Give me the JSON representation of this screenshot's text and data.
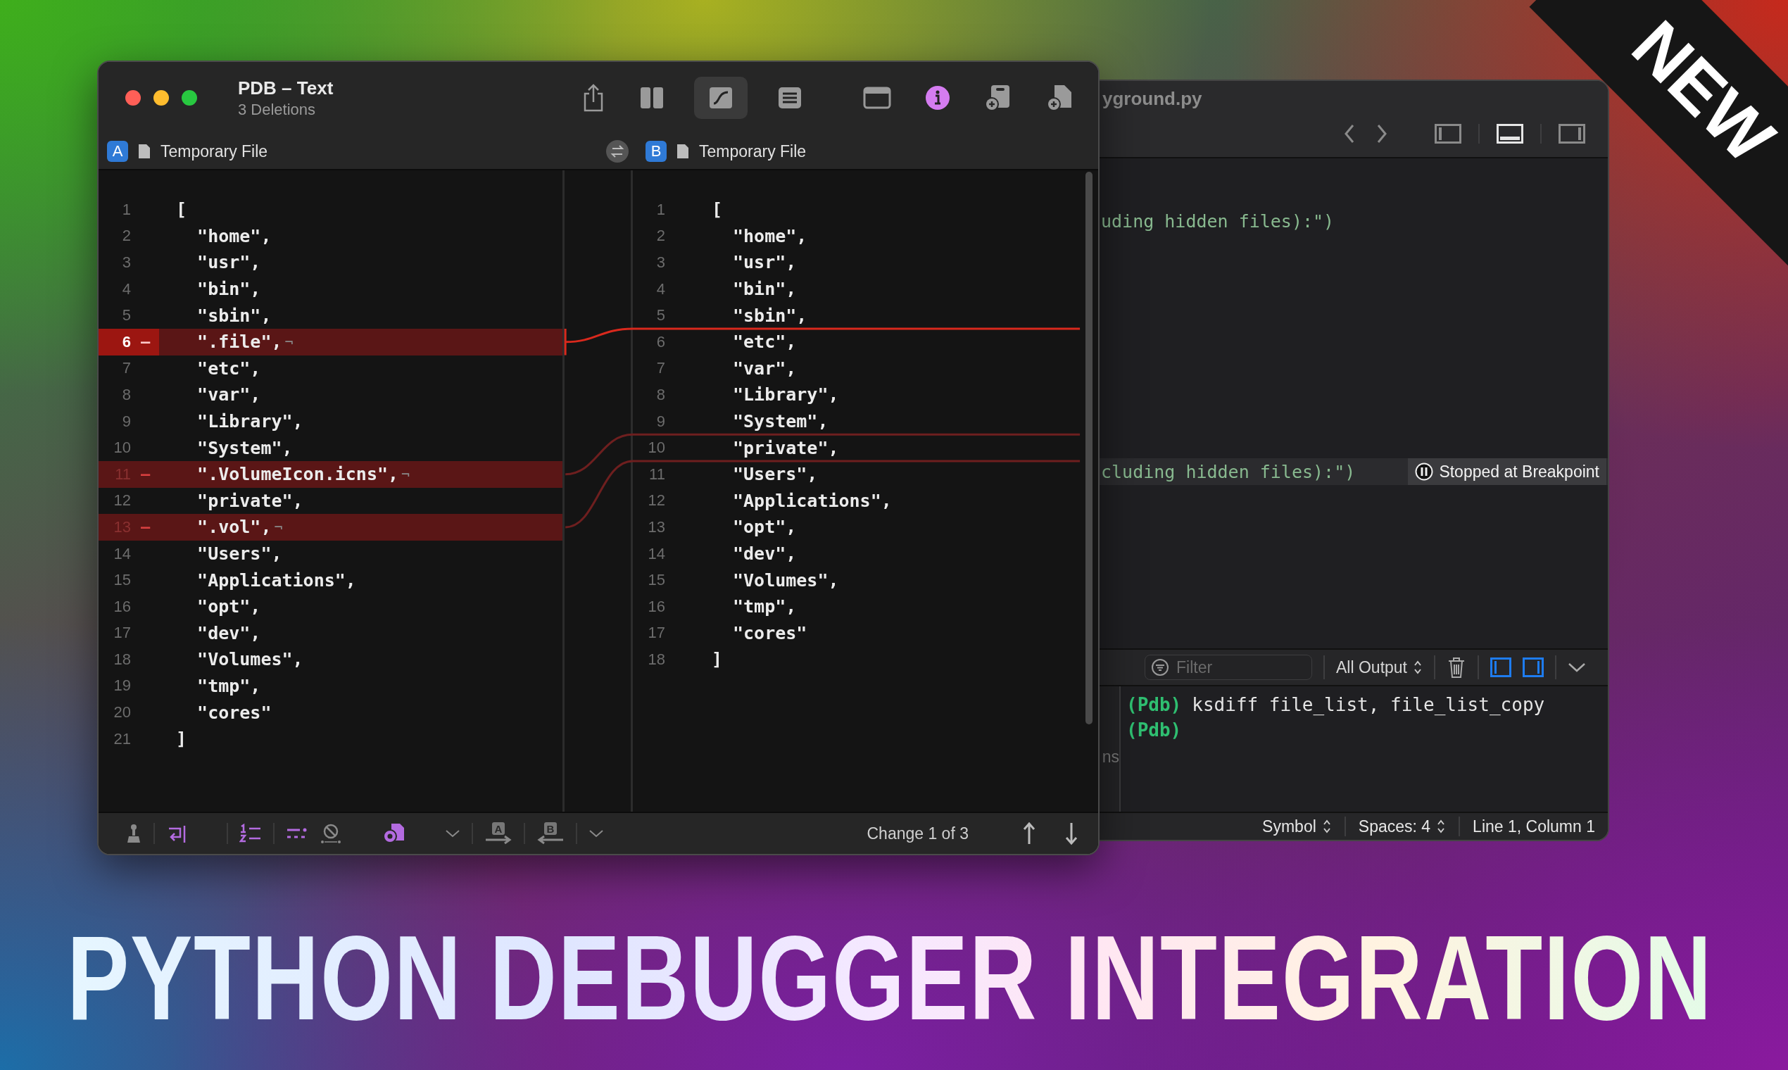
{
  "badge": {
    "text": "NEW"
  },
  "diff_window": {
    "title": "PDB – Text",
    "subtitle": "3 Deletions",
    "toolbar": [
      {
        "kind": "share",
        "selected": false
      },
      {
        "kind": "columns",
        "selected": false
      },
      {
        "kind": "curve",
        "selected": true
      },
      {
        "kind": "lines",
        "selected": false
      },
      {
        "kind": "window",
        "selected": false
      },
      {
        "kind": "info",
        "selected": false
      },
      {
        "kind": "add-doc",
        "selected": false
      },
      {
        "kind": "add-file",
        "selected": false
      }
    ],
    "left_file": {
      "badge": "A",
      "name": "Temporary File"
    },
    "right_file": {
      "badge": "B",
      "name": "Temporary File"
    },
    "left_lines": [
      {
        "number": "1",
        "text": "[",
        "kind": "context",
        "current": false
      },
      {
        "number": "2",
        "text": "  \"home\",",
        "kind": "context",
        "current": false
      },
      {
        "number": "3",
        "text": "  \"usr\",",
        "kind": "context",
        "current": false
      },
      {
        "number": "4",
        "text": "  \"bin\",",
        "kind": "context",
        "current": false
      },
      {
        "number": "5",
        "text": "  \"sbin\",",
        "kind": "context",
        "current": false
      },
      {
        "number": "6",
        "text": "  \".file\",",
        "kind": "deleted",
        "current": true,
        "marker": "–",
        "eol": "¬"
      },
      {
        "number": "7",
        "text": "  \"etc\",",
        "kind": "context",
        "current": false
      },
      {
        "number": "8",
        "text": "  \"var\",",
        "kind": "context",
        "current": false
      },
      {
        "number": "9",
        "text": "  \"Library\",",
        "kind": "context",
        "current": false
      },
      {
        "number": "10",
        "text": "  \"System\",",
        "kind": "context",
        "current": false
      },
      {
        "number": "11",
        "text": "  \".VolumeIcon.icns\",",
        "kind": "deleted",
        "current": false,
        "marker": "–",
        "eol": "¬"
      },
      {
        "number": "12",
        "text": "  \"private\",",
        "kind": "context",
        "current": false
      },
      {
        "number": "13",
        "text": "  \".vol\",",
        "kind": "deleted",
        "current": false,
        "marker": "–",
        "eol": "¬"
      },
      {
        "number": "14",
        "text": "  \"Users\",",
        "kind": "context",
        "current": false
      },
      {
        "number": "15",
        "text": "  \"Applications\",",
        "kind": "context",
        "current": false
      },
      {
        "number": "16",
        "text": "  \"opt\",",
        "kind": "context",
        "current": false
      },
      {
        "number": "17",
        "text": "  \"dev\",",
        "kind": "context",
        "current": false
      },
      {
        "number": "18",
        "text": "  \"Volumes\",",
        "kind": "context",
        "current": false
      },
      {
        "number": "19",
        "text": "  \"tmp\",",
        "kind": "context",
        "current": false
      },
      {
        "number": "20",
        "text": "  \"cores\"",
        "kind": "context",
        "current": false
      },
      {
        "number": "21",
        "text": "]",
        "kind": "context",
        "current": false
      }
    ],
    "right_lines": [
      {
        "number": "1",
        "text": "["
      },
      {
        "number": "2",
        "text": "  \"home\","
      },
      {
        "number": "3",
        "text": "  \"usr\","
      },
      {
        "number": "4",
        "text": "  \"bin\","
      },
      {
        "number": "5",
        "text": "  \"sbin\","
      },
      {
        "number": "6",
        "text": "  \"etc\","
      },
      {
        "number": "7",
        "text": "  \"var\","
      },
      {
        "number": "8",
        "text": "  \"Library\","
      },
      {
        "number": "9",
        "text": "  \"System\","
      },
      {
        "number": "10",
        "text": "  \"private\","
      },
      {
        "number": "11",
        "text": "  \"Users\","
      },
      {
        "number": "12",
        "text": "  \"Applications\","
      },
      {
        "number": "13",
        "text": "  \"opt\","
      },
      {
        "number": "14",
        "text": "  \"dev\","
      },
      {
        "number": "15",
        "text": "  \"Volumes\","
      },
      {
        "number": "16",
        "text": "  \"tmp\","
      },
      {
        "number": "17",
        "text": "  \"cores\""
      },
      {
        "number": "18",
        "text": "]"
      }
    ],
    "bottom_bar": {
      "tools": [
        {
          "kind": "brush"
        },
        {
          "kind": "wrap"
        },
        {
          "kind": "numbers"
        },
        {
          "kind": "invisibles"
        },
        {
          "kind": "ignore"
        },
        {
          "kind": "gear-doc"
        },
        {
          "kind": "chevron"
        },
        {
          "kind": "merge-right",
          "letter": "A"
        },
        {
          "kind": "merge-left",
          "letter": "B"
        },
        {
          "kind": "chevron"
        }
      ],
      "status": "Change 1 of 3",
      "nav": [
        {
          "kind": "up"
        },
        {
          "kind": "down"
        }
      ]
    }
  },
  "editor_window": {
    "title": "yground.py",
    "toolbar": [
      {
        "kind": "back",
        "selected": false
      },
      {
        "kind": "forward",
        "selected": false
      },
      {
        "kind": "left-panel",
        "selected": false
      },
      {
        "kind": "bottom-panel",
        "selected": true
      },
      {
        "kind": "right-panel",
        "selected": false
      }
    ],
    "code_lines": [
      {
        "text": "uding hidden files):\")",
        "current": false
      },
      {
        "text": "cluding hidden files):\")",
        "current": true
      }
    ],
    "breakpoint_badge": "Stopped at Breakpoint",
    "console": {
      "filter_placeholder": "Filter",
      "output_menu": "All Output",
      "lines": [
        {
          "prompt": "(Pdb)",
          "command": "ksdiff file_list, file_list_copy"
        },
        {
          "prompt": "(Pdb)"
        }
      ]
    },
    "sidebar_fragment": "ns",
    "status_bar": [
      {
        "kind": "menu",
        "text": "Symbol"
      },
      {
        "kind": "menu",
        "text": "Spaces: 4"
      },
      {
        "kind": "text",
        "text": "Line 1, Column 1"
      }
    ]
  },
  "headline": "PYTHON DEBUGGER INTEGRATION"
}
